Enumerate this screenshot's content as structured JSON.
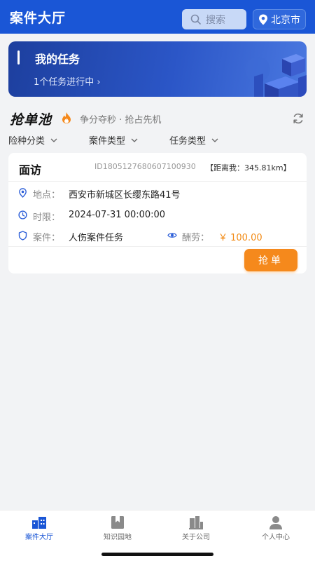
{
  "header": {
    "title": "案件大厅",
    "search_placeholder": "搜索",
    "city": "北京市"
  },
  "banner": {
    "title": "我的任务",
    "subtitle": "1个任务进行中 ›"
  },
  "pool": {
    "title": "抢单池",
    "slogan": "争分夺秒 · 抢占先机"
  },
  "filters": [
    "险种分类",
    "案件类型",
    "任务类型"
  ],
  "card": {
    "title": "面访",
    "id": "ID1805127680607100930",
    "distance": "【距离我：345.81km】",
    "location_label": "地点：",
    "location": "西安市新城区长缨东路41号",
    "deadline_label": "时限：",
    "deadline": "2024-07-31 00:00:00",
    "case_label": "案件：",
    "case": "人伤案件任务",
    "reward_label": "酬劳：",
    "reward": "￥ 100.00",
    "button": "抢单"
  },
  "nav": [
    {
      "label": "案件大厅",
      "icon": "building-icon",
      "active": true
    },
    {
      "label": "知识园地",
      "icon": "book-icon",
      "active": false
    },
    {
      "label": "关于公司",
      "icon": "company-icon",
      "active": false
    },
    {
      "label": "个人中心",
      "icon": "person-icon",
      "active": false
    }
  ],
  "colors": {
    "primary": "#1a56d6",
    "accent": "#f5891c"
  }
}
